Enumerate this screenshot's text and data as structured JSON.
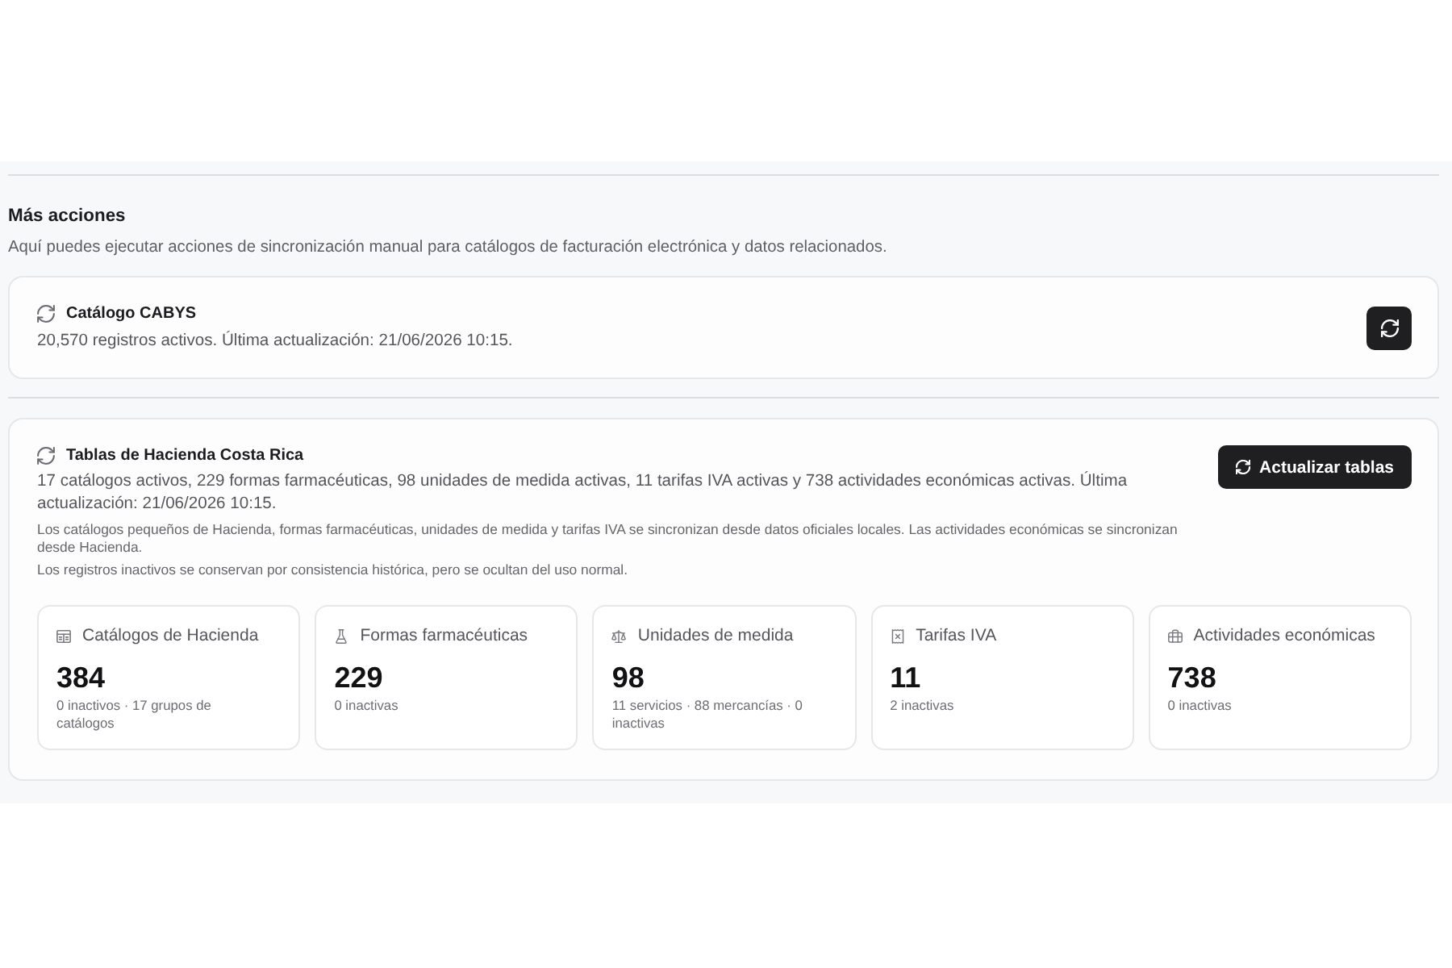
{
  "section": {
    "title": "Más acciones",
    "description": "Aquí puedes ejecutar acciones de sincronización manual para catálogos de facturación electrónica y datos relacionados."
  },
  "cabys": {
    "title": "Catálogo CABYS",
    "description": "20,570 registros activos. Última actualización: 21/06/2026 10:15."
  },
  "hacienda": {
    "title": "Tablas de Hacienda Costa Rica",
    "description": "17 catálogos activos, 229 formas farmacéuticas, 98 unidades de medida activas, 11 tarifas IVA activas y 738 actividades económicas activas. Última actualización: 21/06/2026 10:15.",
    "notes": [
      "Los catálogos pequeños de Hacienda, formas farmacéuticas, unidades de medida y tarifas IVA se sincronizan desde datos oficiales locales. Las actividades económicas se sincronizan desde Hacienda.",
      "Los registros inactivos se conservan por consistencia histórica, pero se ocultan del uso normal."
    ],
    "button": "Actualizar tablas",
    "stats": [
      {
        "kind": "table",
        "label": "Catálogos de Hacienda",
        "value": "384",
        "detail": "0 inactivos · 17 grupos de catálogos"
      },
      {
        "kind": "flask",
        "label": "Formas farmacéuticas",
        "value": "229",
        "detail": "0 inactivas"
      },
      {
        "kind": "scale",
        "label": "Unidades de medida",
        "value": "98",
        "detail": "11 servicios · 88 mercancías · 0 inactivas"
      },
      {
        "kind": "receipt",
        "label": "Tarifas IVA",
        "value": "11",
        "detail": "2 inactivas"
      },
      {
        "kind": "briefcase",
        "label": "Actividades económicas",
        "value": "738",
        "detail": "0 inactivas"
      }
    ]
  }
}
